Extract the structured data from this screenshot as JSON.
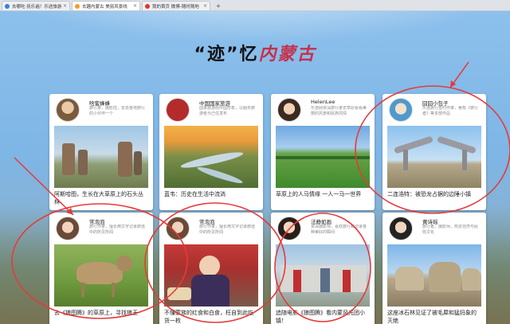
{
  "browser": {
    "tabs": [
      {
        "title": "去哪吃 抚乐遍！乐途旅游",
        "favicon_color": "#2f86d8",
        "active": false
      },
      {
        "title": "去趣内蒙古 美丽风景线",
        "favicon_color": "#f0a020",
        "active": true
      },
      {
        "title": "我的首页 微博-随时随地",
        "favicon_color": "#e0362a",
        "active": false
      }
    ],
    "close_glyph": "×",
    "new_tab_glyph": "+"
  },
  "page": {
    "headline_prefix": "“迹”忆",
    "headline_accent": "内蒙古"
  },
  "cards": [
    {
      "author": "啥蜜蜂蜂",
      "desc": "旅行家，摄影控，爱去各地旅行的小伙伴一个",
      "caption": "阿斯哈图，生长在大草原上的石头丛林"
    },
    {
      "author": "中国国家旅游",
      "desc": "国家旅游局中国形象，以服务旅游者为己任发布",
      "caption": "蓝韦：历史在生活中流淌"
    },
    {
      "author": "HelenLee",
      "desc": "乐途网资深旅行家去草原看看美丽的风景和民族风情",
      "caption": "草原上的人马情缘 一人一马一世界"
    },
    {
      "author": "囧囧小包子",
      "desc": "乐途旅行签约作家，著有《旅行者》等多部作品",
      "caption": "二连浩特：被恐龙占据的边陲小镇"
    },
    {
      "author": "常泡泡",
      "desc": "旅行作家，擅长用文字记录旅途中的所见所闻",
      "caption": "去《狼图腾》的草原上，寻找狼王"
    },
    {
      "author": "常泡泡",
      "desc": "旅行作家，擅长用文字记录旅途中的所见所闻",
      "caption": "不懂蒙族的红食和白食，枉自到此吃货一枚"
    },
    {
      "author": "法静如画",
      "desc": "资深摄影师，喜欢旅行和记录各种美好的瞬间",
      "caption": "追随电影《狼图腾》看内蒙风光团小镇！"
    },
    {
      "author": "黄诗瑶",
      "desc": "旅行者，摄影师，热爱自然与民俗文化",
      "caption": "这座冰石林见证了被毛犀和猛犸象的灭绝"
    }
  ]
}
